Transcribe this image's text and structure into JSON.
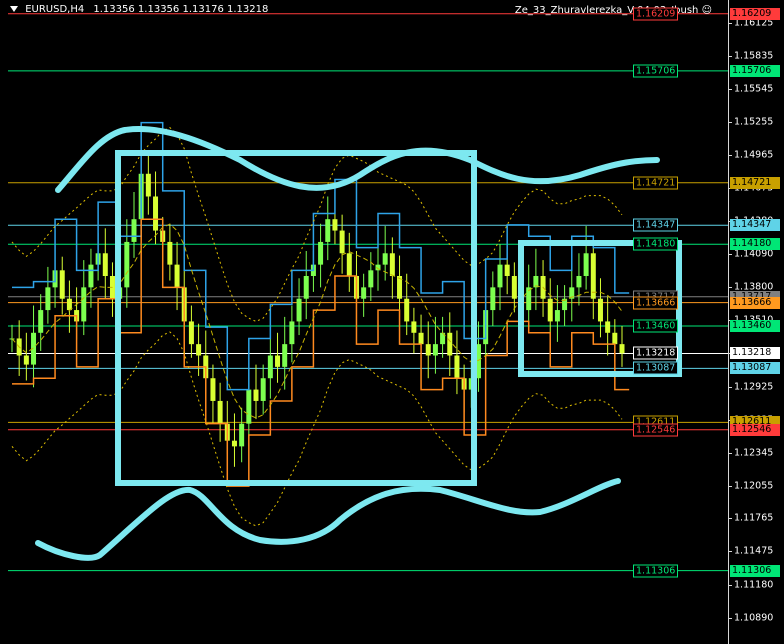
{
  "header": {
    "symbol": "EURUSD,H4",
    "ohlc": "1.13356 1.13356 1.13176 1.13218"
  },
  "indicator": "Ze_33_Zhuravlerezka_V-04-03_Ibush",
  "chart_data": {
    "type": "candlestick",
    "instrument": "EURUSD",
    "timeframe": "H4",
    "ylim": [
      1.1066,
      1.1633
    ],
    "y_ticks": [
      "1.16125",
      "1.15835",
      "1.15545",
      "1.15255",
      "1.14965",
      "1.14675",
      "1.14380",
      "1.14090",
      "1.13800",
      "1.13510",
      "1.13220",
      "1.12925",
      "1.12635",
      "1.12345",
      "1.12055",
      "1.11765",
      "1.11475",
      "1.11180",
      "1.10890"
    ],
    "horizontal_levels": [
      {
        "value": 1.16209,
        "label": "1.16209",
        "color": "#ff3b3b"
      },
      {
        "value": 1.15706,
        "label": "1.15706",
        "color": "#00e676"
      },
      {
        "value": 1.14721,
        "label": "1.14721",
        "color": "#c8a000"
      },
      {
        "value": 1.14347,
        "label": "1.14347",
        "color": "#5fd3e8"
      },
      {
        "value": 1.1418,
        "label": "1.14180",
        "color": "#00e676"
      },
      {
        "value": 1.13717,
        "label": "1.13717",
        "color": "#808080"
      },
      {
        "value": 1.13666,
        "label": "1.13666",
        "color": "#ff9a1f"
      },
      {
        "value": 1.1346,
        "label": "1.13460",
        "color": "#00e676"
      },
      {
        "value": 1.13218,
        "label": "1.13218",
        "color": "#ffffff"
      },
      {
        "value": 1.13087,
        "label": "1.13087",
        "color": "#5fd3e8"
      },
      {
        "value": 1.12611,
        "label": "1.12611",
        "color": "#c8a000"
      },
      {
        "value": 1.12546,
        "label": "1.12546",
        "color": "#ff3b3b"
      },
      {
        "value": 1.11306,
        "label": "1.11306",
        "color": "#00e676"
      }
    ],
    "current_price": 1.13218,
    "close_series": [
      1.1335,
      1.132,
      1.1312,
      1.134,
      1.136,
      1.138,
      1.1395,
      1.137,
      1.136,
      1.135,
      1.138,
      1.14,
      1.141,
      1.139,
      1.137,
      1.138,
      1.142,
      1.144,
      1.148,
      1.146,
      1.143,
      1.142,
      1.14,
      1.138,
      1.135,
      1.133,
      1.132,
      1.13,
      1.128,
      1.126,
      1.1245,
      1.124,
      1.126,
      1.129,
      1.128,
      1.13,
      1.132,
      1.131,
      1.133,
      1.135,
      1.137,
      1.139,
      1.14,
      1.142,
      1.144,
      1.143,
      1.141,
      1.139,
      1.137,
      1.138,
      1.1395,
      1.14,
      1.141,
      1.139,
      1.137,
      1.135,
      1.134,
      1.133,
      1.132,
      1.133,
      1.134,
      1.132,
      1.13,
      1.129,
      1.13,
      1.133,
      1.136,
      1.138,
      1.14,
      1.139,
      1.137,
      1.136,
      1.138,
      1.139,
      1.137,
      1.135,
      1.136,
      1.137,
      1.138,
      1.139,
      1.141,
      1.137,
      1.135,
      1.134,
      1.133,
      1.1322
    ],
    "overlay_annotations": {
      "color": "#7de8f0",
      "shapes": [
        "rectangle",
        "rectangle",
        "curve",
        "curve"
      ]
    }
  }
}
